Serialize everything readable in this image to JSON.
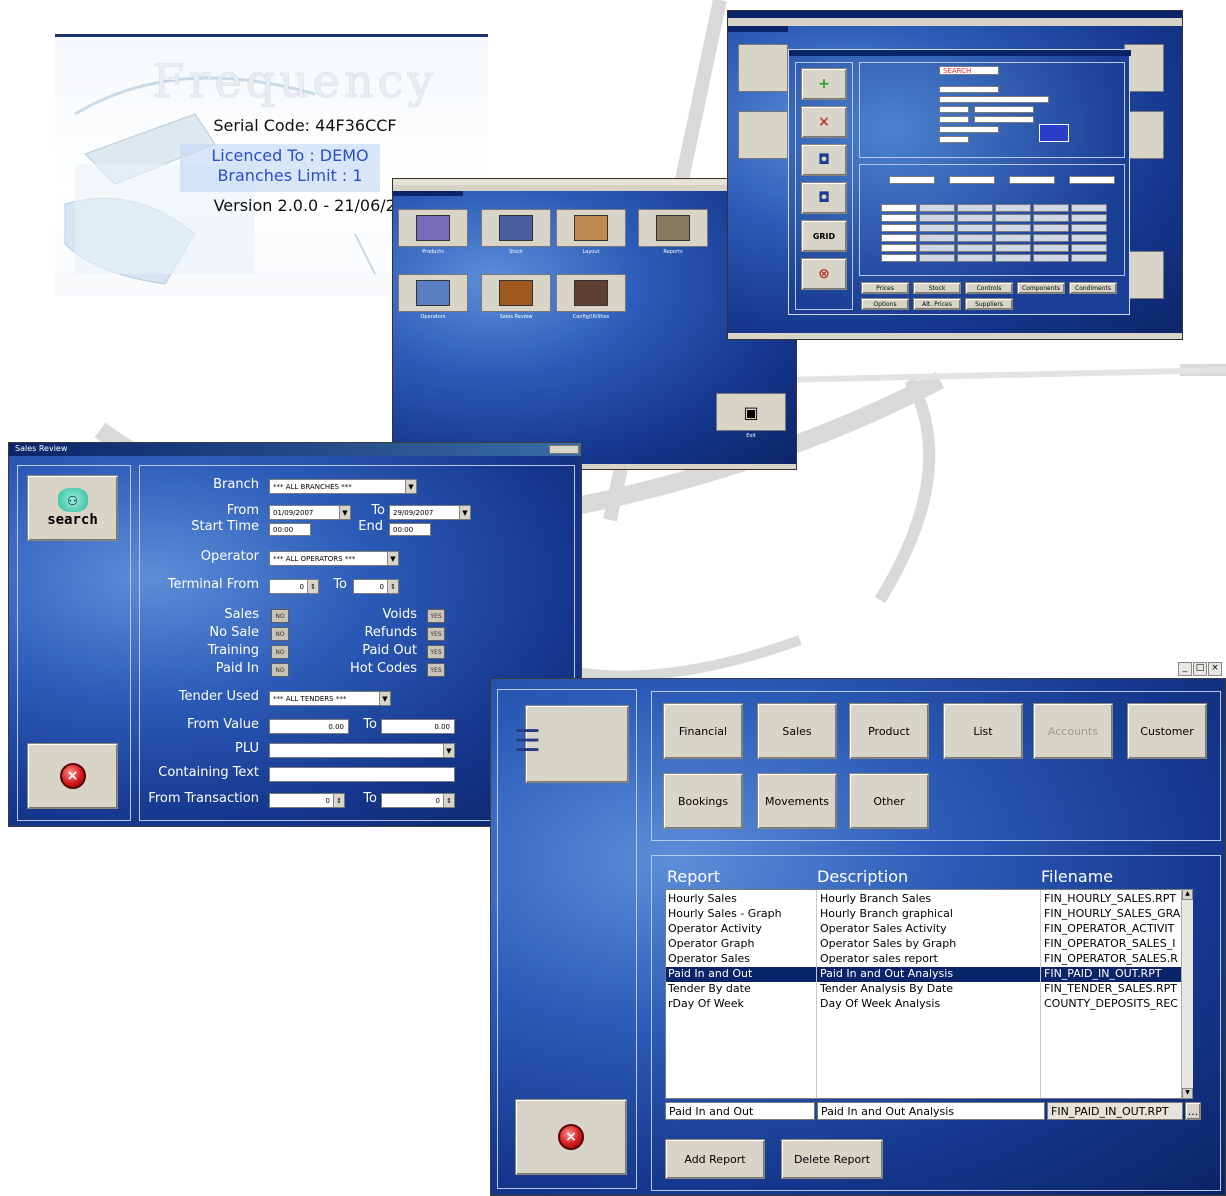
{
  "splash": {
    "logo_text": "Frequency",
    "serial": "Serial Code: 44F36CCF",
    "licenced": "Licenced To : DEMO",
    "branches": "Branches Limit : 1",
    "version": "Version 2.0.0 - 21/06/2007"
  },
  "main_menu": {
    "tiles": [
      {
        "label": "Products"
      },
      {
        "label": "Stock"
      },
      {
        "label": "Layout"
      },
      {
        "label": "Reports"
      },
      {
        "label": "Operators"
      },
      {
        "label": "Sales Review"
      },
      {
        "label": "Config/Utilities"
      }
    ],
    "exit_label": "Exit"
  },
  "product_window": {
    "search_value": "SEARCH",
    "side_buttons": [
      "+",
      "×",
      "◘",
      "◘",
      "GRID",
      "⊗"
    ],
    "bottom_buttons_row1": [
      "Prices",
      "Stock",
      "Controls",
      "Components",
      "Condiments"
    ],
    "bottom_buttons_row2": [
      "Options",
      "Alt. Prices",
      "Suppliers"
    ]
  },
  "sales_review": {
    "title": "Sales Review",
    "search_label": "search",
    "branch_label": "Branch",
    "branch_value": "*** ALL BRANCHES ***",
    "from_label": "From",
    "from_value": "01/09/2007",
    "to_label": "To",
    "to_value": "29/09/2007",
    "start_time_label": "Start Time",
    "start_time_value": "00:00",
    "end_label": "End",
    "end_value": "00:00",
    "operator_label": "Operator",
    "operator_value": "*** ALL OPERATORS ***",
    "terminal_from_label": "Terminal From",
    "terminal_from_value": "0",
    "terminal_to_label": "To",
    "terminal_to_value": "0",
    "sales_label": "Sales",
    "voids_label": "Voids",
    "no_sale_label": "No Sale",
    "refunds_label": "Refunds",
    "training_label": "Training",
    "paid_out_label": "Paid Out",
    "paid_in_label": "Paid In",
    "hot_codes_label": "Hot Codes",
    "yes_text": "YES",
    "no_text": "NO",
    "tender_used_label": "Tender Used",
    "tender_used_value": "*** ALL TENDERS ***",
    "from_value_label": "From Value",
    "from_value_value": "0.00",
    "to_value_label": "To",
    "to_value_value": "0.00",
    "plu_label": "PLU",
    "containing_text_label": "Containing Text",
    "from_transaction_label": "From Transaction",
    "from_transaction_value": "0",
    "to_transaction_label": "To",
    "to_transaction_value": "0"
  },
  "reports": {
    "categories": [
      {
        "label": "Financial",
        "enabled": true
      },
      {
        "label": "Sales",
        "enabled": true
      },
      {
        "label": "Product",
        "enabled": true
      },
      {
        "label": "List",
        "enabled": true
      },
      {
        "label": "Accounts",
        "enabled": false
      },
      {
        "label": "Customer",
        "enabled": true
      },
      {
        "label": "Bookings",
        "enabled": true
      },
      {
        "label": "Movements",
        "enabled": true
      },
      {
        "label": "Other",
        "enabled": true
      }
    ],
    "col_report": "Report",
    "col_description": "Description",
    "col_filename": "Filename",
    "rows": [
      {
        "report": "Hourly Sales",
        "description": "Hourly Branch Sales",
        "filename": "FIN_HOURLY_SALES.RPT"
      },
      {
        "report": "Hourly Sales - Graph",
        "description": "Hourly Branch graphical",
        "filename": "FIN_HOURLY_SALES_GRA"
      },
      {
        "report": "Operator Activity",
        "description": "Operator Sales Activity",
        "filename": "FIN_OPERATOR_ACTIVIT"
      },
      {
        "report": "Operator Graph",
        "description": "Operator Sales by Graph",
        "filename": "FIN_OPERATOR_SALES_I"
      },
      {
        "report": "Operator Sales",
        "description": "Operator sales report",
        "filename": "FIN_OPERATOR_SALES.R"
      },
      {
        "report": "Paid In and Out",
        "description": "Paid In and Out Analysis",
        "filename": "FIN_PAID_IN_OUT.RPT",
        "selected": true
      },
      {
        "report": "Tender By date",
        "description": "Tender Analysis By Date",
        "filename": "FIN_TENDER_SALES.RPT"
      },
      {
        "report": "rDay Of Week",
        "description": "Day Of Week Analysis",
        "filename": "COUNTY_DEPOSITS_REC"
      }
    ],
    "edit_report": "Paid In and Out",
    "edit_description": "Paid In and Out Analysis",
    "edit_filename": "FIN_PAID_IN_OUT.RPT",
    "browse_label": "...",
    "add_report_label": "Add Report",
    "delete_report_label": "Delete Report",
    "window_buttons": "_ □ ×"
  }
}
